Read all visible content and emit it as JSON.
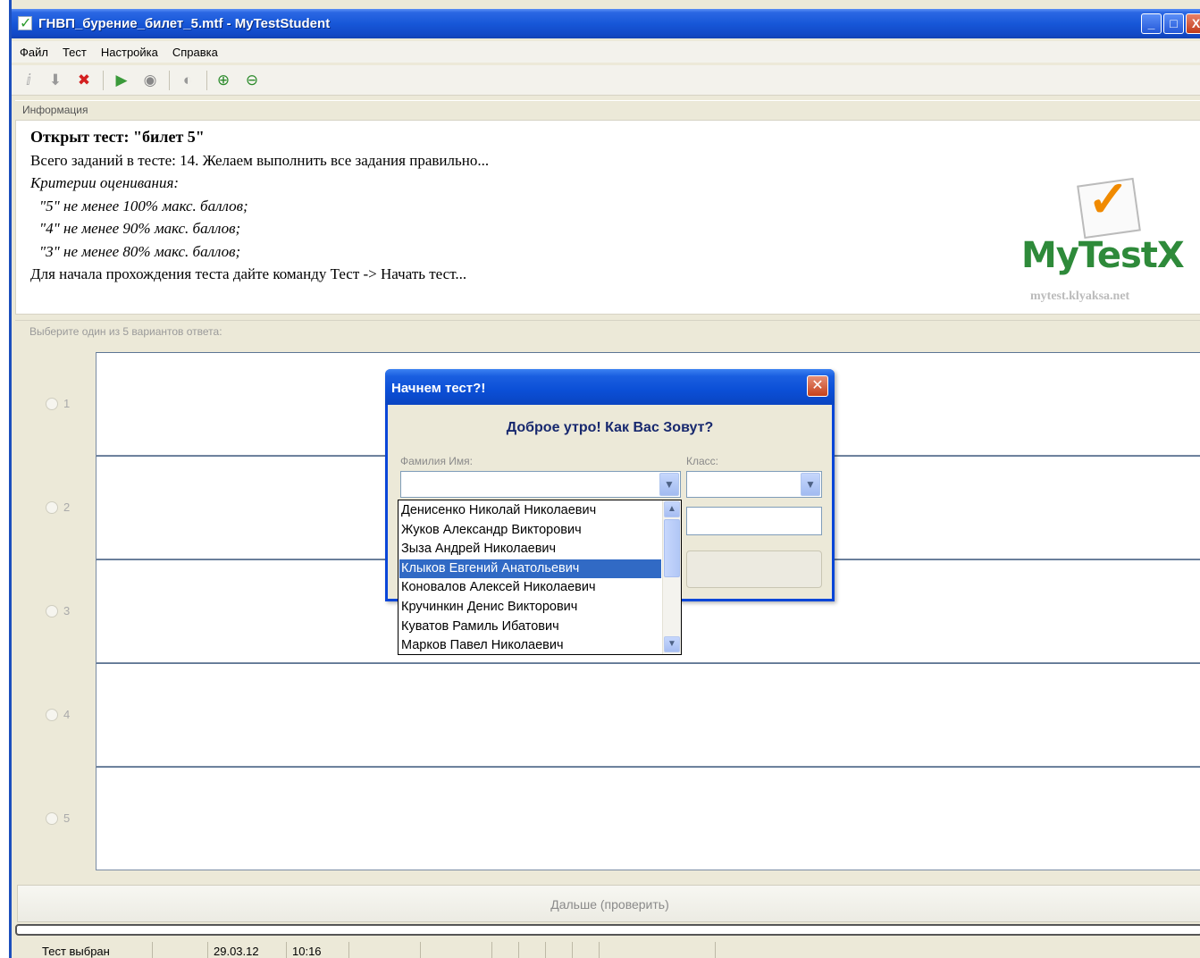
{
  "window": {
    "title": "ГНВП_бурение_билет_5.mtf - MyTestStudent",
    "controls": {
      "minimize": "_",
      "maximize": "□",
      "close": "X"
    }
  },
  "menu": [
    "Файл",
    "Тест",
    "Настройка",
    "Справка"
  ],
  "toolbar": {
    "icons": [
      "info-icon",
      "download-arrow-icon",
      "delete-icon",
      "play-icon",
      "stop-icon",
      "pause-icon",
      "zoom-in-icon",
      "zoom-out-icon"
    ]
  },
  "info": {
    "header": "Информация",
    "lines": [
      "Открыт тест: \"билет 5\"",
      "Всего заданий в тесте: 14. Желаем выполнить все задания правильно...",
      "Критерии оценивания:",
      "\"5\" не менее 100% макс. баллов;",
      "\"4\" не менее 90% макс. баллов;",
      "\"3\" не менее 80% макс. баллов;",
      "Для начала прохождения теста дайте команду Тест -> Начать тест..."
    ],
    "logo": {
      "brand": "MyTestX",
      "site": "mytest.klyaksa.net"
    }
  },
  "answers": {
    "header": "Выберите один из 5 вариантов ответа:",
    "options": [
      "1",
      "2",
      "3",
      "4",
      "5"
    ]
  },
  "next_button": "Дальше (проверить)",
  "status": {
    "state": "Тест выбран",
    "date": "29.03.12",
    "time": "10:16"
  },
  "dialog": {
    "title": "Начнем тест?!",
    "greeting": "Доброе утро! Как Вас Зовут?",
    "name_label": "Фамилия Имя:",
    "class_label": "Класс:",
    "name_value": "",
    "class_value": "",
    "names": [
      "Денисенко Николай Николаевич",
      "Жуков Александр Викторович",
      "Зыза Андрей Николаевич",
      "Клыков Евгений Анатольевич",
      "Коновалов Алексей Николаевич",
      "Кручинкин Денис Викторович",
      "Куватов Рамиль Ибатович",
      "Марков Павел Николаевич"
    ],
    "selected_index": 3
  },
  "colors": {
    "title_blue": "#0a46d8",
    "selection_blue": "#316ac5",
    "logo_green": "#2e8a3a",
    "check_orange": "#f08a00"
  }
}
